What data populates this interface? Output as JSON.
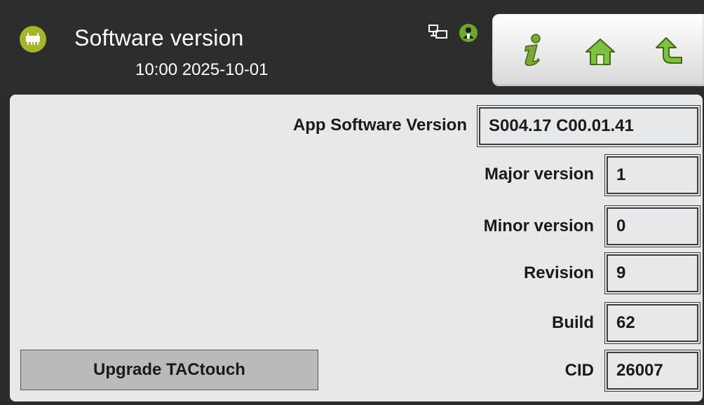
{
  "header": {
    "title": "Software version",
    "time": "10:00",
    "date": "2025-10-01",
    "chip_icon": "chip-icon",
    "status_icons": [
      "network-icon",
      "user-icon"
    ],
    "colors": {
      "header_bg": "#2d2d2d",
      "accent": "#a8b52a"
    }
  },
  "toolbar": {
    "buttons": [
      {
        "name": "info-button",
        "icon": "info-icon"
      },
      {
        "name": "home-button",
        "icon": "home-icon"
      },
      {
        "name": "back-button",
        "icon": "back-arrow-icon"
      }
    ]
  },
  "fields": {
    "app_software_version": {
      "label": "App Software Version",
      "value": "S004.17  C00.01.41"
    },
    "major_version": {
      "label": "Major version",
      "value": "1"
    },
    "minor_version": {
      "label": "Minor version",
      "value": "0"
    },
    "revision": {
      "label": "Revision",
      "value": "9"
    },
    "build": {
      "label": "Build",
      "value": "62"
    },
    "cid": {
      "label": "CID",
      "value": "26007"
    }
  },
  "upgrade_button": {
    "label": "Upgrade TACtouch"
  }
}
